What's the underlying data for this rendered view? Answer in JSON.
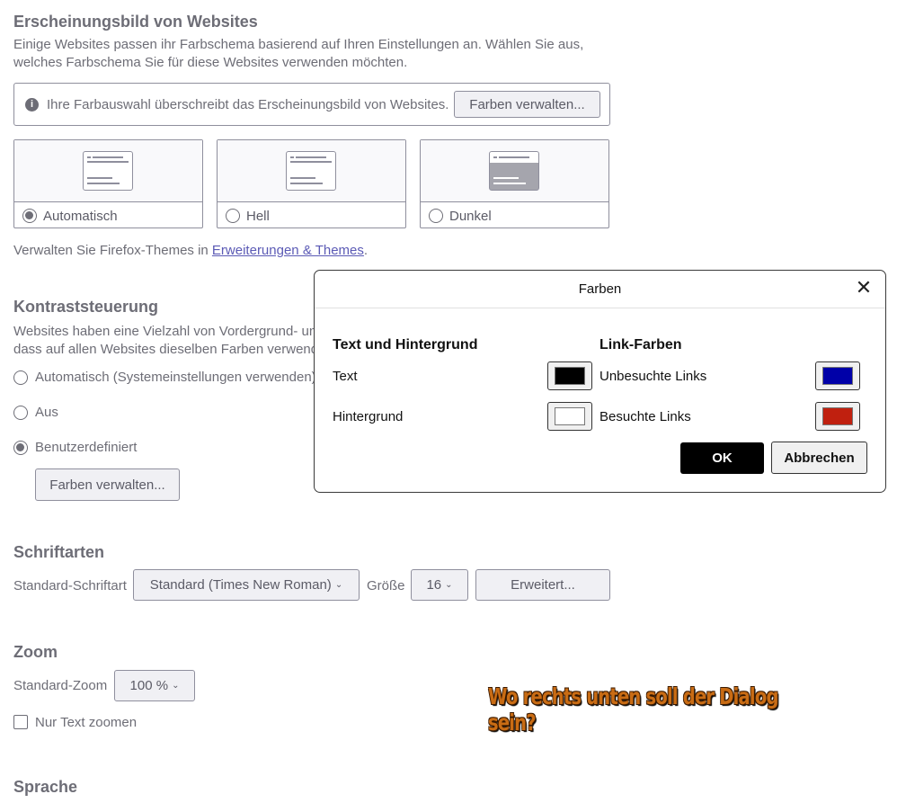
{
  "appearance": {
    "heading": "Erscheinungsbild von Websites",
    "desc_line1": "Einige Websites passen ihr Farbschema basierend auf Ihren Einstellungen an. Wählen Sie aus,",
    "desc_line2": "welches Farbschema Sie für diese Websites verwenden möchten.",
    "notice": "Ihre Farbauswahl überschreibt das Erscheinungsbild von Websites.",
    "manage_colors_button": "Farben verwalten...",
    "options": [
      {
        "label": "Automatisch",
        "selected": true
      },
      {
        "label": "Hell",
        "selected": false
      },
      {
        "label": "Dunkel",
        "selected": false
      }
    ],
    "themes_text": "Verwalten Sie Firefox-Themes in ",
    "themes_link": "Erweiterungen & Themes",
    "themes_end": "."
  },
  "contrast": {
    "heading": "Kontraststeuerung",
    "desc_line1": "Websites haben eine Vielzahl von Vordergrund- un",
    "desc_line2": "dass auf allen Websites dieselben Farben verwende",
    "options": [
      {
        "label": "Automatisch (Systemeinstellungen verwenden)",
        "selected": false
      },
      {
        "label": "Aus",
        "selected": false
      },
      {
        "label": "Benutzerdefiniert",
        "selected": true
      }
    ],
    "manage_colors_button": "Farben verwalten..."
  },
  "fonts": {
    "heading": "Schriftarten",
    "default_font_label": "Standard-Schriftart",
    "default_font_value": "Standard (Times New Roman)",
    "size_label": "Größe",
    "size_value": "16",
    "advanced_button": "Erweitert..."
  },
  "zoom": {
    "heading": "Zoom",
    "default_zoom_label": "Standard-Zoom",
    "default_zoom_value": "100 %",
    "text_only_label": "Nur Text zoomen",
    "text_only_checked": false
  },
  "language": {
    "heading": "Sprache"
  },
  "dialog": {
    "title": "Farben",
    "text_bg_heading": "Text und Hintergrund",
    "link_heading": "Link-Farben",
    "text_label": "Text",
    "background_label": "Hintergrund",
    "unvisited_label": "Unbesuchte Links",
    "visited_label": "Besuchte Links",
    "ok_button": "OK",
    "cancel_button": "Abbrechen",
    "colors": {
      "text": "#000000",
      "background": "#ffffff",
      "unvisited": "#0000a8",
      "visited": "#c0200f"
    }
  },
  "annotation": "Wo rechts unten soll der Dialog sein?",
  "icons": {
    "info": "info-icon",
    "close": "close-icon",
    "chevron": "chevron-down-icon"
  }
}
